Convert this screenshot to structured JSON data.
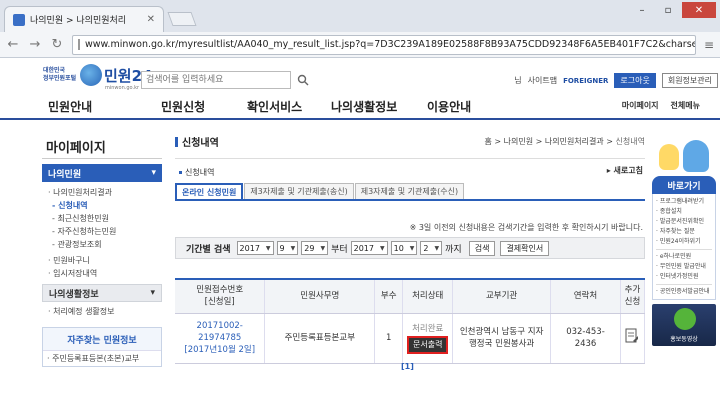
{
  "browser": {
    "tab_title": "나의민원 > 나의민원처리",
    "url": "www.minwon.go.kr/myresultlist/AA040_my_result_list.jsp?q=7D3C239A189E02588F8B93A75CDD92348F6A5EB401F7C2&charset=E..."
  },
  "header": {
    "logo_small_1": "대한민국",
    "logo_small_2": "정부민원포털",
    "logo_main": "민원24",
    "logo_sub": "minwon.go.kr",
    "search_placeholder": "검색어를 입력하세요",
    "link_guest": "님",
    "link_sitemap": "사이트맵",
    "link_foreigner": "FOREIGNER",
    "btn_logout": "로그아웃",
    "btn_member": "회원정보관리"
  },
  "gnb": {
    "items": [
      "민원안내",
      "민원신청",
      "확인서비스",
      "나의생활정보",
      "이용안내"
    ],
    "mypage": "마이페이지",
    "allmenu": "전체메뉴"
  },
  "lnb": {
    "title": "마이페이지",
    "selected": "나의민원",
    "sub1": "나의민원처리결과",
    "sub2": "신청내역",
    "sub3": "최근신청한민원",
    "sub4": "자주신청하는민원",
    "sub5": "관광정보조회",
    "sub6": "민원바구니",
    "sub7": "임시저장내역",
    "gray": "나의생활정보",
    "gray_sub": "처리예정 생활정보",
    "box_title": "자주찾는 민원정보",
    "box_item": "주민등록표등본(초본)교부"
  },
  "main": {
    "title": "신청내역",
    "breadcrumb_1": "홈",
    "breadcrumb_2": "나의민원",
    "breadcrumb_3": "나의민원처리결과",
    "breadcrumb_4": "신청내역",
    "sub_title": "신청내역",
    "refresh": "새로고침",
    "tabs": [
      "온라인 신청민원",
      "제3자제출 및 기관제출(송신)",
      "제3자제출 및 기관제출(수신)"
    ],
    "notice": "※ 3일 이전의 신청내용은 검색기간을 입력한 후 확인하시기 바랍니다.",
    "filter_label": "기간별 검색",
    "from_year": "2017",
    "from_month": "9",
    "from_day": "29",
    "from_label": "부터",
    "to_year": "2017",
    "to_month": "10",
    "to_day": "2",
    "to_label": "까지",
    "btn_search": "검색",
    "btn_result": "결제확인서"
  },
  "table": {
    "headers": {
      "no_1": "민원접수번호",
      "no_2": "[신청일]",
      "name": "민원사무명",
      "count": "부수",
      "status": "처리상태",
      "agency": "교부기관",
      "contact": "연락처",
      "extra_1": "추가",
      "extra_2": "신청"
    },
    "row": {
      "no_1": "20171002-",
      "no_2": "21974785",
      "date": "[2017년10월 2일]",
      "name": "주민등록표등본교부",
      "count": "1",
      "status": "처리완료",
      "print": "문서출력",
      "agency_1": "인천광역시 남동구 지자",
      "agency_2": "행정국 민원봉사과",
      "contact_1": "032-453-",
      "contact_2": "2436"
    },
    "paging": "[1]"
  },
  "right": {
    "quick_title": "바로가기",
    "quick_items": [
      "프로그램내려받기",
      "종합설치",
      "발급문서진위확인",
      "자주찾는 질문",
      "민원24이하위기"
    ],
    "quick_items2": [
      "e하나로민원",
      "무인민원 발급안내",
      "인터넷가정민원"
    ],
    "quick_items3": [
      "공인인증서발급안내"
    ],
    "promo": "홍보동영상"
  },
  "colors": {
    "accent": "#2a5eb8",
    "print_highlight": "#e02020"
  }
}
